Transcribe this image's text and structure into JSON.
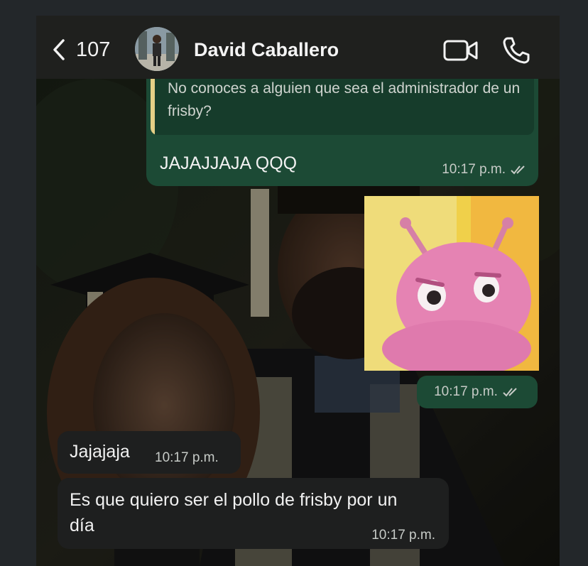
{
  "header": {
    "back_count": "107",
    "contact_name": "David Caballero"
  },
  "messages": {
    "quoted_text": "No conoces a alguien que sea el administrador de un frisby?",
    "out_text": "JAJAJJAJA QQQ",
    "out_time": "10:17 p.m.",
    "sticker_time": "10:17 p.m.",
    "in1_text": "Jajajaja",
    "in1_time": "10:17 p.m.",
    "in2_text": "Es que quiero ser el pollo de frisby por un día",
    "in2_time": "10:17 p.m."
  },
  "colors": {
    "outgoing_bubble": "#1c4a35",
    "incoming_bubble": "#1e1f1f",
    "quote_bar": "#e5cf86",
    "header_bg": "#1f201e"
  },
  "icons": [
    "chevron-left-icon",
    "video-camera-icon",
    "phone-icon",
    "double-check-icon"
  ]
}
